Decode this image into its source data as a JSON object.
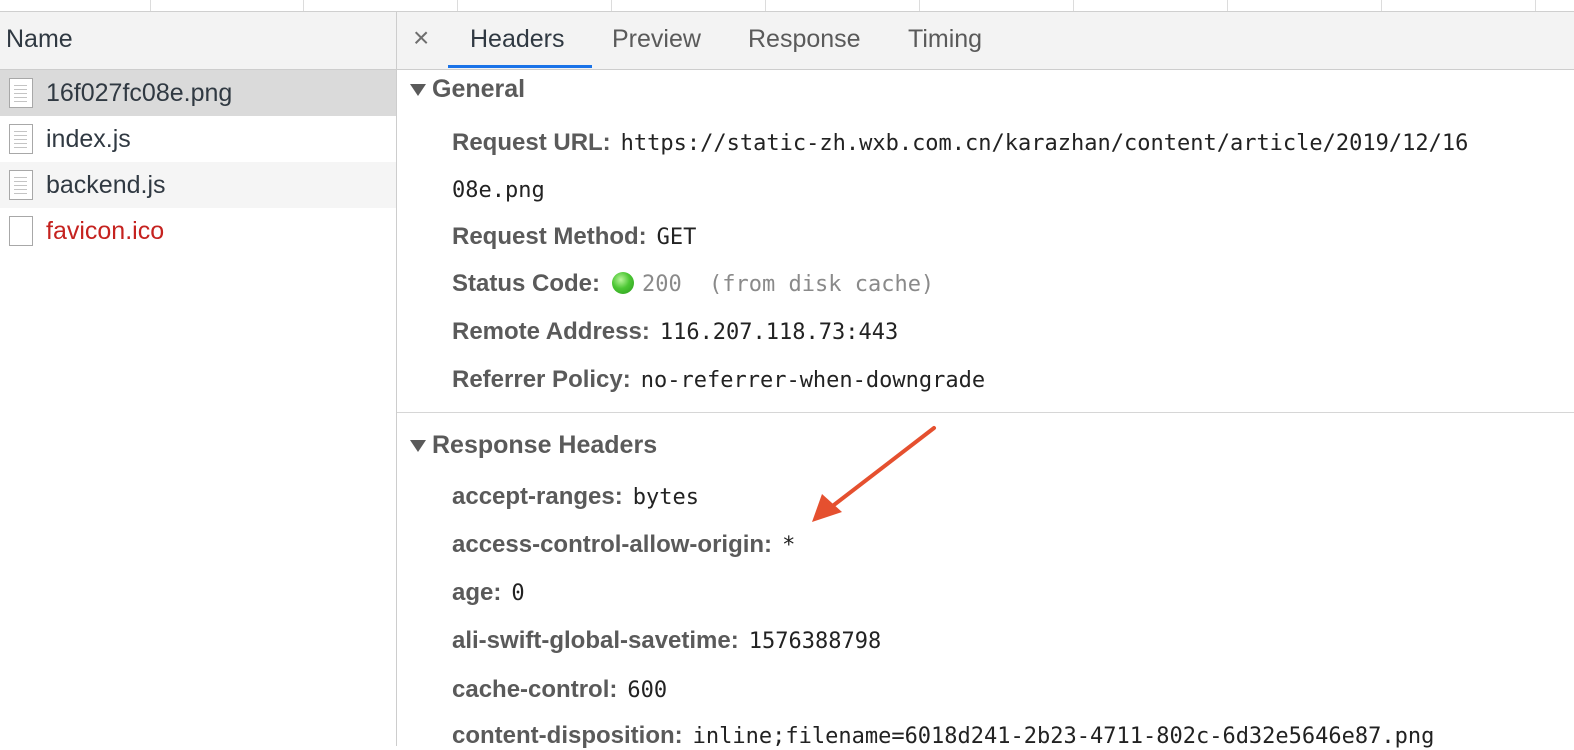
{
  "file_list": {
    "column_header": "Name",
    "items": [
      {
        "name": "16f027fc08e.png",
        "state": "selected"
      },
      {
        "name": "index.js",
        "state": "normal"
      },
      {
        "name": "backend.js",
        "state": "normal"
      },
      {
        "name": "favicon.ico",
        "state": "error"
      }
    ]
  },
  "tabs": {
    "close_glyph": "×",
    "items": [
      "Headers",
      "Preview",
      "Response",
      "Timing"
    ],
    "active": "Headers"
  },
  "general": {
    "title": "General",
    "request_url_label": "Request URL:",
    "request_url_line1": "https://static-zh.wxb.com.cn/karazhan/content/article/2019/12/16",
    "request_url_line2": "08e.png",
    "request_method_label": "Request Method:",
    "request_method": "GET",
    "status_code_label": "Status Code:",
    "status_code": "200",
    "status_note": " (from disk cache)",
    "remote_address_label": "Remote Address:",
    "remote_address": "116.207.118.73:443",
    "referrer_policy_label": "Referrer Policy:",
    "referrer_policy": "no-referrer-when-downgrade"
  },
  "response_headers": {
    "title": "Response Headers",
    "items": [
      {
        "key": "accept-ranges:",
        "value": "bytes"
      },
      {
        "key": "access-control-allow-origin:",
        "value": "*"
      },
      {
        "key": "age:",
        "value": "0"
      },
      {
        "key": "ali-swift-global-savetime:",
        "value": "1576388798"
      },
      {
        "key": "cache-control:",
        "value": "600"
      },
      {
        "key": "content-disposition:",
        "value": "inline;filename=6018d241-2b23-4711-802c-6d32e5646e87.png"
      }
    ]
  },
  "annotation": {
    "icon": "arrow-icon",
    "color": "#e5502f"
  },
  "colors": {
    "accent": "#1a73e8",
    "error": "#c5221f",
    "selected_row": "#dadada",
    "status_ok": "#4cc734"
  }
}
